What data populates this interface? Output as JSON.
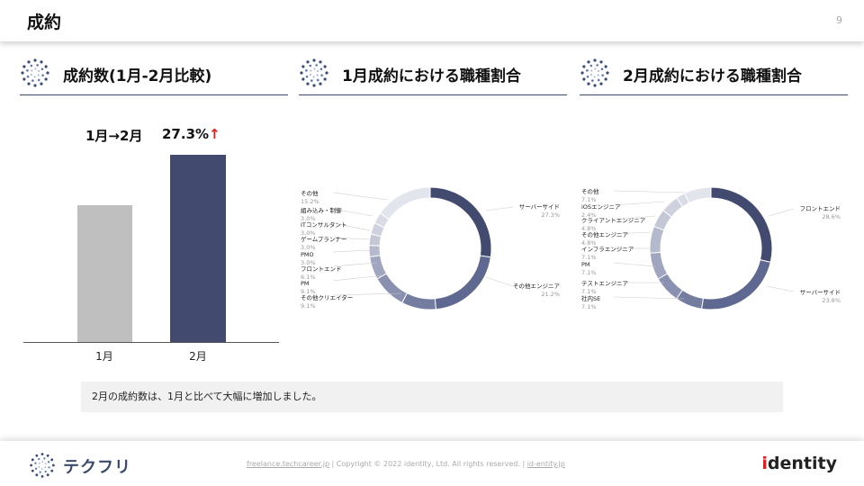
{
  "header": {
    "title": "成約",
    "page_number": "9"
  },
  "sections": [
    {
      "title": "成約数(1月-2月比較)"
    },
    {
      "title": "1月成約における職種割合"
    },
    {
      "title": "2月成約における職種割合"
    }
  ],
  "comparison": {
    "label": "1月→2月",
    "value": "27.3%",
    "arrow": "↑"
  },
  "chart_data": [
    {
      "type": "bar",
      "categories": [
        "1月",
        "2月"
      ],
      "values": [
        100,
        127.3
      ],
      "colors": [
        "#bfbfbf",
        "#424a70"
      ],
      "ylim": [
        0,
        140
      ]
    },
    {
      "type": "pie",
      "donut": true,
      "slices": [
        {
          "label": "サーバーサイド",
          "pct": "27.3%",
          "value": 27.3,
          "color": "#424a70"
        },
        {
          "label": "その他エンジニア",
          "pct": "21.2%",
          "value": 21.2,
          "color": "#5f6890"
        },
        {
          "label": "その他クリエイター",
          "pct": "9.1%",
          "value": 9.1,
          "color": "#747ca0"
        },
        {
          "label": "PM",
          "pct": "9.1%",
          "value": 9.1,
          "color": "#8a91b0"
        },
        {
          "label": "フロントエンド",
          "pct": "6.1%",
          "value": 6.1,
          "color": "#a0a6c0"
        },
        {
          "label": "PMO",
          "pct": "3.0%",
          "value": 3.0,
          "color": "#b4b9cd"
        },
        {
          "label": "ゲームプランナー",
          "pct": "3.0%",
          "value": 3.0,
          "color": "#c3c7d6"
        },
        {
          "label": "ITコンサルタント",
          "pct": "3.0%",
          "value": 3.0,
          "color": "#cfd2de"
        },
        {
          "label": "組み込み・制御",
          "pct": "3.0%",
          "value": 3.0,
          "color": "#d9dbe5"
        },
        {
          "label": "その他",
          "pct": "15.2%",
          "value": 15.2,
          "color": "#e3e5ec"
        }
      ]
    },
    {
      "type": "pie",
      "donut": true,
      "slices": [
        {
          "label": "フロントエンド",
          "pct": "28.6%",
          "value": 28.6,
          "color": "#424a70"
        },
        {
          "label": "サーバーサイド",
          "pct": "23.8%",
          "value": 23.8,
          "color": "#5f6890"
        },
        {
          "label": "社内SE",
          "pct": "7.1%",
          "value": 7.1,
          "color": "#747ca0"
        },
        {
          "label": "テストエンジニア",
          "pct": "7.1%",
          "value": 7.1,
          "color": "#8a91b0"
        },
        {
          "label": "PM",
          "pct": "7.1%",
          "value": 7.1,
          "color": "#a0a6c0"
        },
        {
          "label": "インフラエンジニア",
          "pct": "7.1%",
          "value": 7.1,
          "color": "#b4b9cd"
        },
        {
          "label": "その他エンジニア",
          "pct": "4.8%",
          "value": 4.8,
          "color": "#c3c7d6"
        },
        {
          "label": "クライアントエンジニア",
          "pct": "4.8%",
          "value": 4.8,
          "color": "#cfd2de"
        },
        {
          "label": "iOSエンジニア",
          "pct": "2.4%",
          "value": 2.4,
          "color": "#d9dbe5"
        },
        {
          "label": "その他",
          "pct": "7.1%",
          "value": 7.1,
          "color": "#e3e5ec"
        }
      ]
    }
  ],
  "note": "2月の成約数は、1月と比べて大幅に増加しました。",
  "footer": {
    "brand": "テクフリ",
    "link1": "freelance.techcareer.jp",
    "copyright": "  |  Copyright © 2022 identity, Ltd. All rights reserved.  |  ",
    "link2": "id-entity.jp",
    "identity_pre": "",
    "identity_i": "i",
    "identity_rest": "dentity"
  },
  "icons": {
    "section": "dot-circle-logo-icon",
    "brand": "dot-circle-logo-icon"
  },
  "colors": {
    "accent": "#424a70",
    "arrow": "#e02020",
    "bar_prev": "#bfbfbf"
  }
}
